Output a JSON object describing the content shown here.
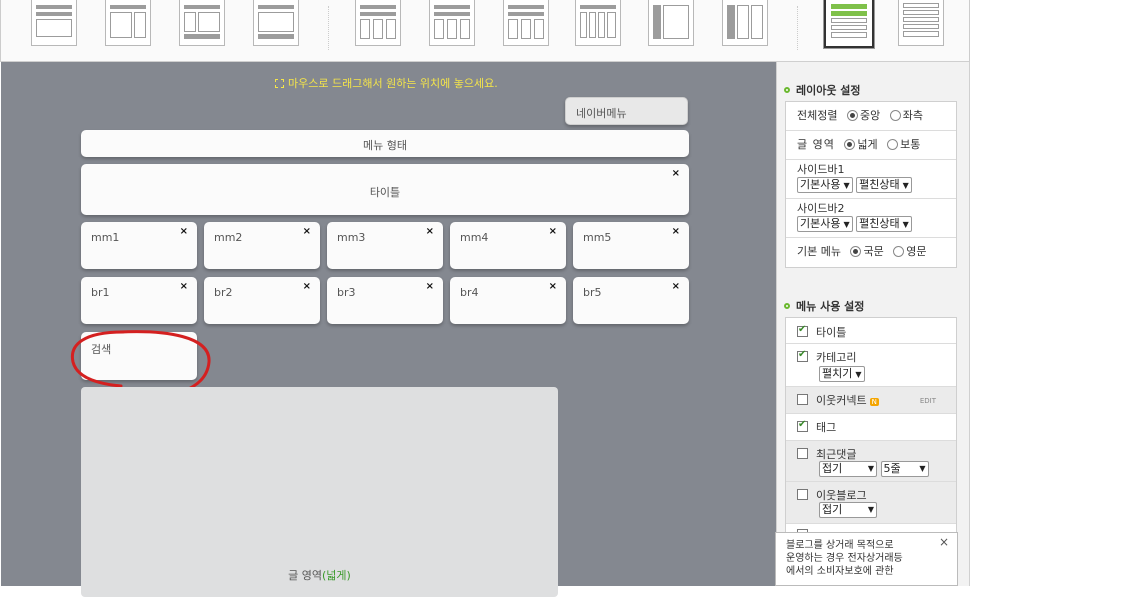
{
  "hint": "마우스로 드래그해서 원하는 위치에 놓으세요.",
  "naver_menu": "네이버메뉴",
  "menu_shape": "메뉴 형태",
  "title_box": "타이틀",
  "close_glyph": "×",
  "mm_boxes": [
    "mm1",
    "mm2",
    "mm3",
    "mm4",
    "mm5"
  ],
  "br_boxes": [
    "br1",
    "br2",
    "br3",
    "br4",
    "br5"
  ],
  "search_box": "검색",
  "article": {
    "label": "글 영역",
    "suffix": "(넓게)"
  },
  "layout_settings": {
    "heading": "레이아웃 설정",
    "align_label": "전체정렬",
    "align_options": [
      "중앙",
      "좌측"
    ],
    "align_selected": "중앙",
    "content_label": "글 영역",
    "content_options": [
      "넓게",
      "보통"
    ],
    "content_selected": "넓게",
    "sidebar1_label": "사이드바1",
    "sidebar1_use": "기본사용",
    "sidebar1_state": "펼친상태",
    "sidebar2_label": "사이드바2",
    "sidebar2_use": "기본사용",
    "sidebar2_state": "펼친상태",
    "menu_label": "기본 메뉴",
    "menu_options": [
      "국문",
      "영문"
    ],
    "menu_selected": "국문"
  },
  "menu_settings": {
    "heading": "메뉴 사용 설정",
    "title": "타이틀",
    "category": "카테고리",
    "category_mode": "펼치기",
    "neighbor_connect": "이웃커넥트",
    "neighbor_badge": "N",
    "edit_label": "EDIT",
    "tag": "태그",
    "recent_comments": "최근댓글",
    "recent_fold": "접기",
    "recent_count": "5줄",
    "neighbor_blog": "이웃블로그",
    "neighbor_blog_fold": "접기"
  },
  "popup": {
    "lines": [
      "블로그를 상거래 목적으로",
      "운영하는 경우 전자상거래등",
      "에서의 소비자보호에 관한"
    ],
    "close": "×"
  },
  "colors": {
    "accent_green": "#6ab82e",
    "work_bg": "#848890",
    "hint_yellow": "#f4e54a",
    "red_mark": "#d42020"
  }
}
